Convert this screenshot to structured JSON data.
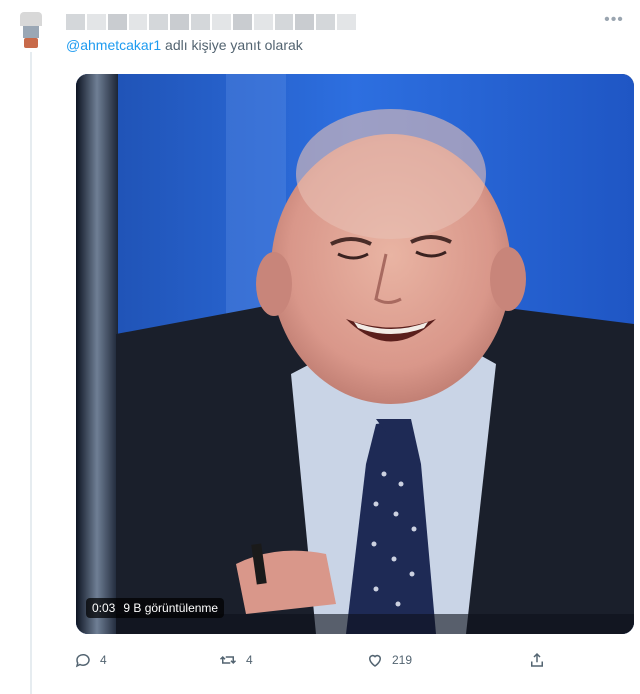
{
  "tweet": {
    "reply_prefix_handle": "@ahmetcakar1",
    "reply_suffix": " adlı kişiye yanıt olarak"
  },
  "video": {
    "duration": "0:03",
    "views": "9 B görüntülenme"
  },
  "actions": {
    "replies": "4",
    "retweets": "4",
    "likes": "219"
  },
  "icons": {
    "reply": "reply-icon",
    "retweet": "retweet-icon",
    "like": "heart-icon",
    "share": "share-icon",
    "more": "more-dots-icon"
  },
  "colors": {
    "mention": "#1d9bf0",
    "secondary_text": "#536471"
  }
}
